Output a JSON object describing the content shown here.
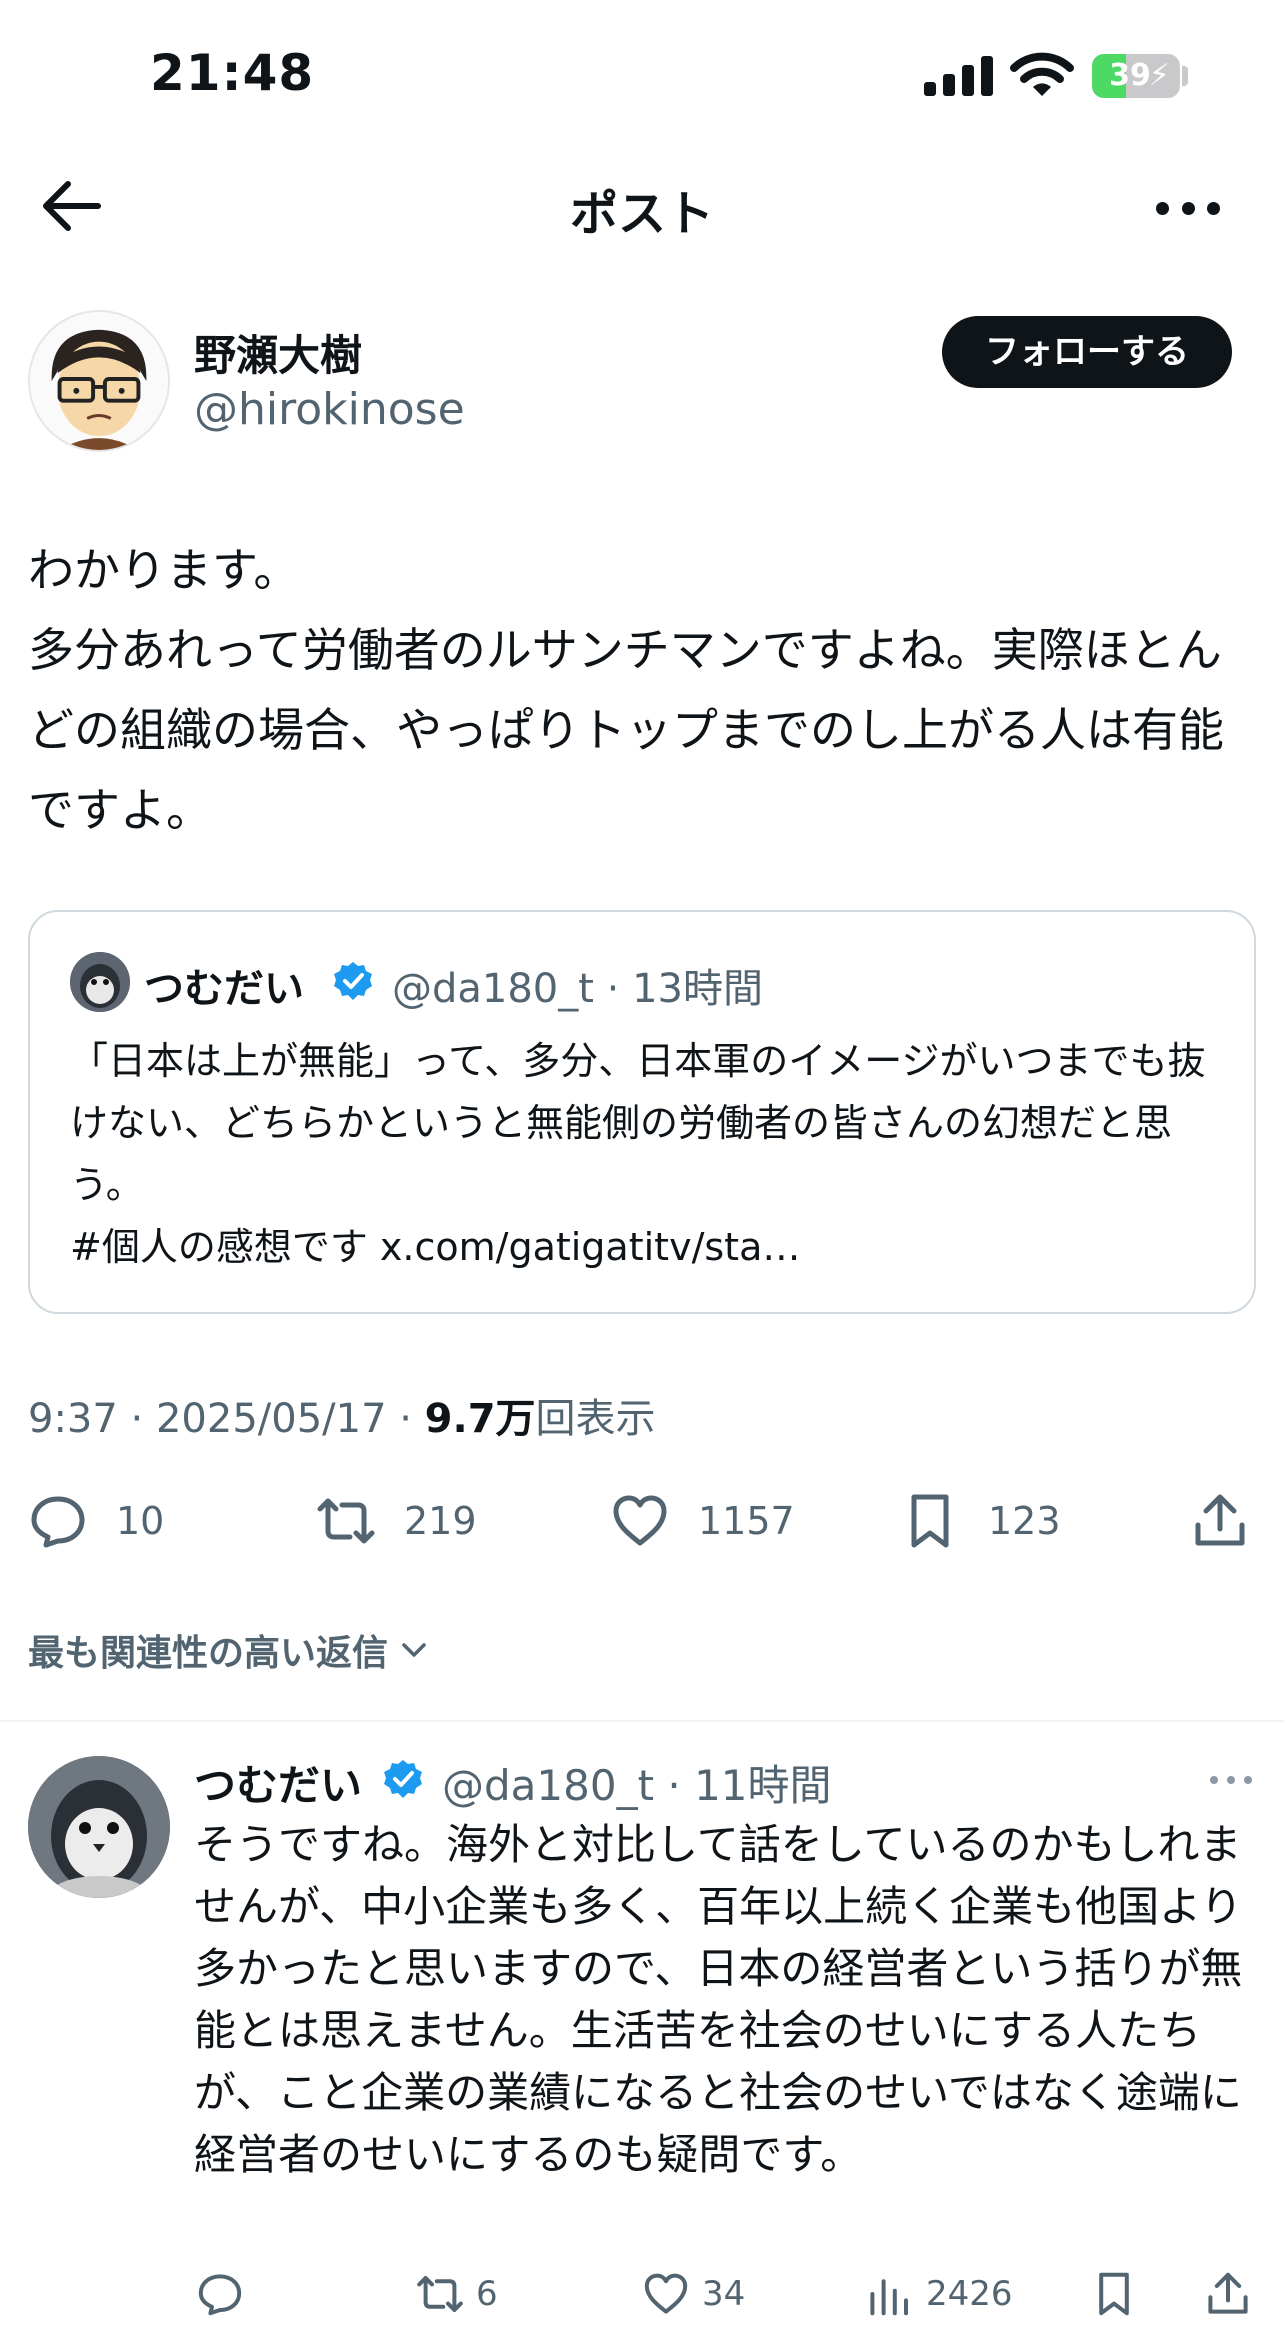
{
  "status_bar": {
    "time": "21:48",
    "battery_level": "39",
    "icons": [
      "cellular-signal-icon",
      "wifi-icon",
      "battery-charging-icon"
    ]
  },
  "nav": {
    "title": "ポスト",
    "icons": [
      "back-arrow-icon",
      "more-icon"
    ]
  },
  "post": {
    "author_name": "野瀬大樹",
    "author_handle": "@hirokinose",
    "follow_label": "フォローする",
    "text": "わかります。\n多分あれって労働者のルサンチマンですよね。実際ほとんどの組織の場合、やっぱりトップまでのし上がる人は有能ですよ。",
    "meta_prefix": "9:37 · 2025/05/17 · ",
    "views_count": "9.7万",
    "views_label": "回表示",
    "stats": {
      "replies": "10",
      "reposts": "219",
      "likes": "1157",
      "bookmarks": "123"
    }
  },
  "quote": {
    "author_name": "つむだい",
    "author_handle": "@da180_t · 13時間",
    "text": "「日本は上が無能」って、多分、日本軍のイメージがいつまでも抜けない、どちらかというと無能側の労働者の皆さんの幻想だと思う。\n#個人の感想です x.com/gatigatitv/sta…"
  },
  "replies_section": {
    "sort_label": "最も関連性の高い返信"
  },
  "reply": {
    "author_name": "つむだい",
    "author_handle": "@da180_t · 11時間",
    "text": "そうですね。海外と対比して話をしているのかもしれませんが、中小企業も多く、百年以上続く企業も他国より多かったと思いますので、日本の経営者という括りが無能とは思えません。生活苦を社会のせいにする人たちが、こと企業の業績になると社会のせいではなく途端に経営者のせいにするのも疑問です。",
    "stats": {
      "replies": "",
      "reposts": "6",
      "likes": "34",
      "views": "2426"
    }
  },
  "colors": {
    "text": "#0f1419",
    "secondary": "#536471",
    "verified": "#1d9bf0",
    "border": "#cfd9de",
    "battery": "#4cd964"
  }
}
